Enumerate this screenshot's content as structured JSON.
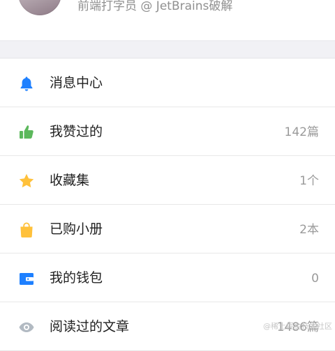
{
  "profile": {
    "description": "前端打字员 @ JetBrains破解"
  },
  "menu": [
    {
      "label": "消息中心",
      "count": "",
      "icon": "bell-icon",
      "color": "#1e80ff"
    },
    {
      "label": "我赞过的",
      "count": "142篇",
      "icon": "thumbs-up-icon",
      "color": "#5cb85c"
    },
    {
      "label": "收藏集",
      "count": "1个",
      "icon": "star-icon",
      "color": "#ffc13b"
    },
    {
      "label": "已购小册",
      "count": "2本",
      "icon": "shopping-bag-icon",
      "color": "#ffc13b"
    },
    {
      "label": "我的钱包",
      "count": "0",
      "icon": "wallet-icon",
      "color": "#1e80ff"
    },
    {
      "label": "阅读过的文章",
      "count": "1486篇",
      "icon": "eye-icon",
      "color": "#b2bac2"
    }
  ],
  "watermark": "@稀土掘金技术社区"
}
